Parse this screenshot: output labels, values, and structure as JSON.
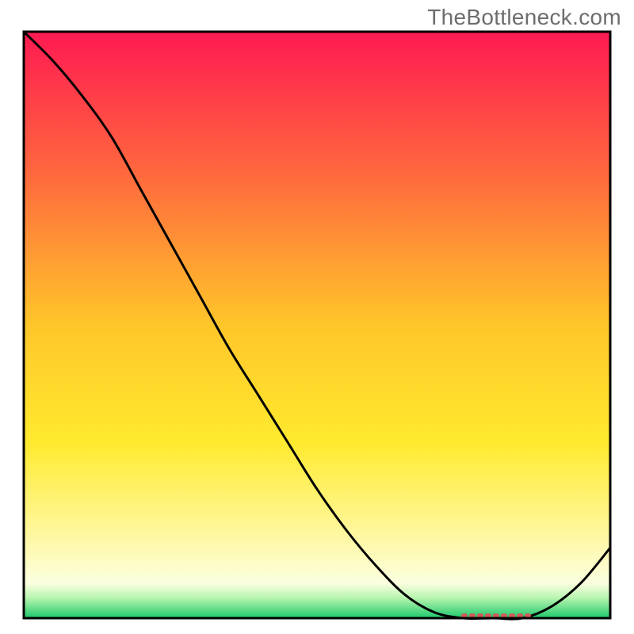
{
  "watermark": "TheBottleneck.com",
  "chart_data": {
    "type": "line",
    "title": "",
    "xlabel": "",
    "ylabel": "",
    "x": [
      0,
      5,
      10,
      15,
      20,
      25,
      30,
      35,
      40,
      45,
      50,
      55,
      60,
      65,
      70,
      75,
      80,
      85,
      90,
      95,
      100
    ],
    "values": [
      100,
      95,
      89,
      82,
      73,
      64,
      55,
      46,
      38,
      30,
      22,
      15,
      9,
      4,
      1,
      0,
      0,
      0,
      2,
      6,
      12
    ],
    "xlim": [
      0,
      100
    ],
    "ylim": [
      0,
      100
    ],
    "annotation": {
      "x_start": 75,
      "x_end": 87,
      "y": 0,
      "style": "dotted",
      "color": "#d45a5a"
    },
    "background": {
      "type": "vertical-gradient",
      "stops": [
        {
          "pos": 0.0,
          "color": "#ff1a52"
        },
        {
          "pos": 0.25,
          "color": "#ff6b3d"
        },
        {
          "pos": 0.5,
          "color": "#ffc62a"
        },
        {
          "pos": 0.7,
          "color": "#ffea2e"
        },
        {
          "pos": 0.85,
          "color": "#fff79a"
        },
        {
          "pos": 0.94,
          "color": "#fcffe0"
        },
        {
          "pos": 0.965,
          "color": "#b9f5b0"
        },
        {
          "pos": 1.0,
          "color": "#1ec96b"
        }
      ]
    }
  }
}
